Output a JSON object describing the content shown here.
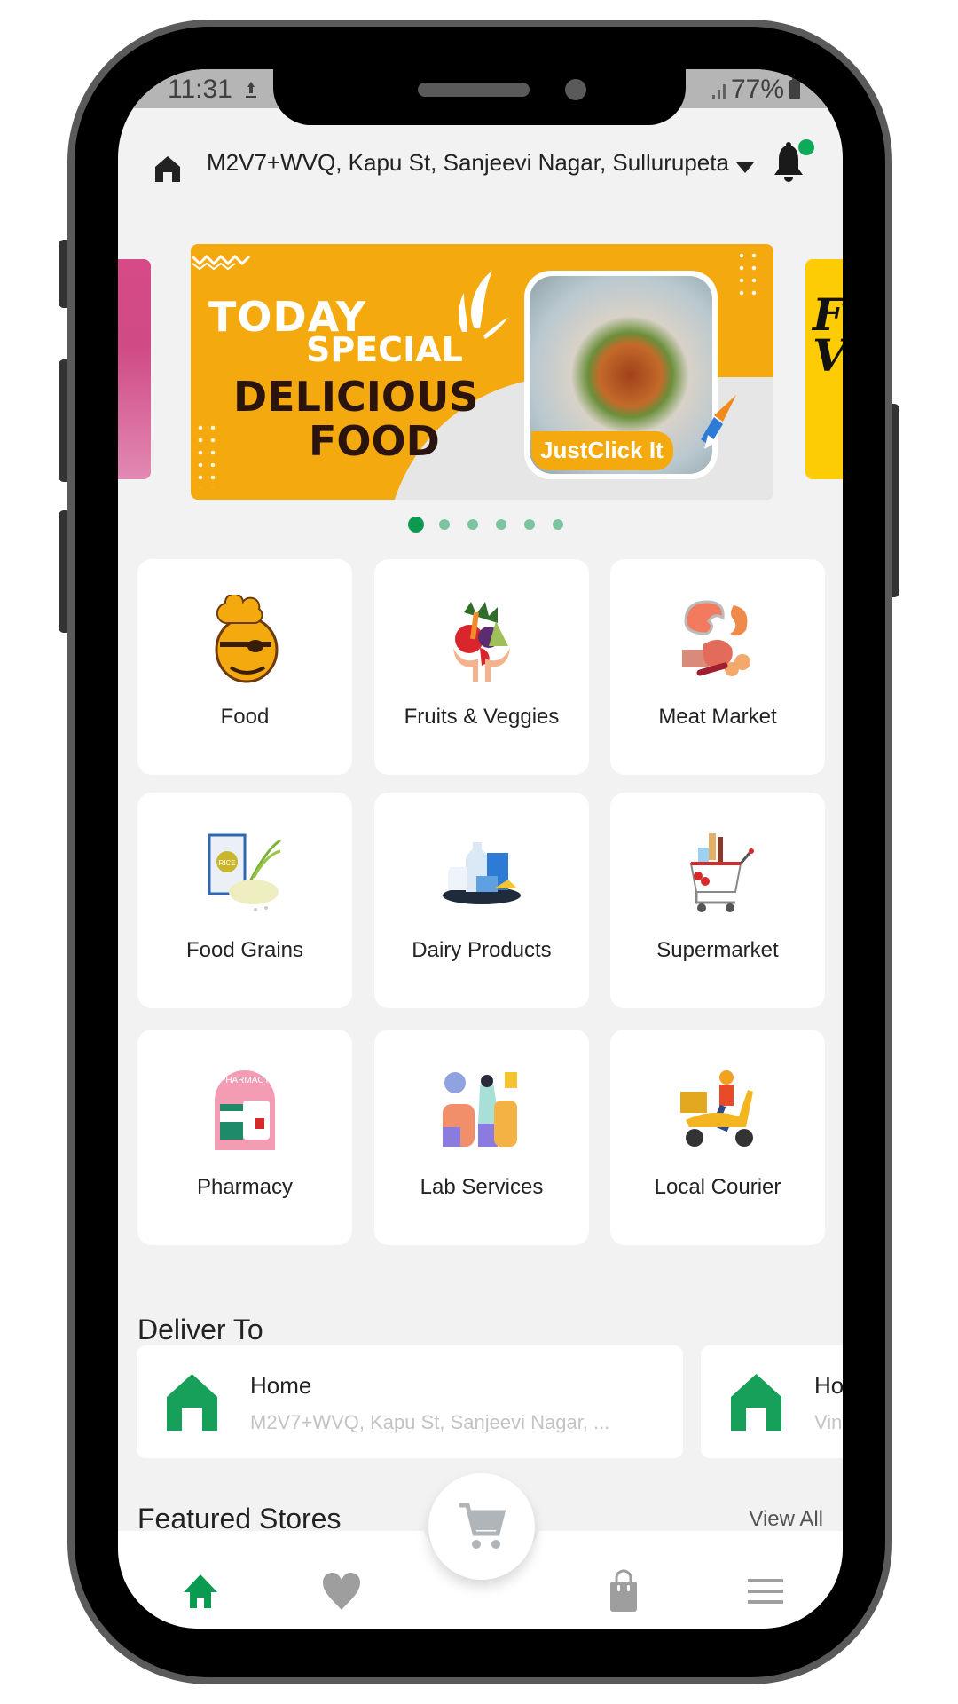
{
  "status_bar": {
    "time": "11:31",
    "battery": "77%",
    "icons": [
      "upload-icon",
      "signal-icon",
      "battery-icon"
    ]
  },
  "header": {
    "location_icon": "home-icon",
    "address": "M2V7+WVQ, Kapu St, Sanjeevi Nagar, Sullurupeta,...",
    "dropdown_icon": "caret-down-icon",
    "notification_icon": "bell-icon",
    "notification_badge_color": "#0fa95a"
  },
  "carousel": {
    "active_banner": {
      "line1": "TODAY",
      "line2": "SPECIAL",
      "line3": "DELICIOUS",
      "line4": "FOOD",
      "badge": "JustClick It"
    },
    "next_banner_text": "Fi\nV",
    "dots_count": 6,
    "active_index": 0,
    "active_color": "#0a9a50",
    "inactive_color": "#7cc4a0"
  },
  "categories": [
    {
      "label": "Food",
      "icon": "chef-food-icon"
    },
    {
      "label": "Fruits & Veggies",
      "icon": "fruits-veggies-icon"
    },
    {
      "label": "Meat Market",
      "icon": "meat-icon"
    },
    {
      "label": "Food Grains",
      "icon": "rice-bag-icon"
    },
    {
      "label": "Dairy Products",
      "icon": "dairy-icon"
    },
    {
      "label": "Supermarket",
      "icon": "shopping-cart-groceries-icon"
    },
    {
      "label": "Pharmacy",
      "icon": "pharmacy-icon"
    },
    {
      "label": "Lab Services",
      "icon": "lab-microscope-icon"
    },
    {
      "label": "Local Courier",
      "icon": "delivery-scooter-icon"
    }
  ],
  "deliver_to": {
    "title": "Deliver To",
    "addresses": [
      {
        "name": "Home",
        "address": "M2V7+WVQ, Kapu St, Sanjeevi Nagar, ..."
      },
      {
        "name": "Ho",
        "address": "Vin"
      }
    ],
    "accent_color": "#16a05a"
  },
  "featured": {
    "title": "Featured Stores",
    "link": "View All"
  },
  "bottom_nav": {
    "items": [
      {
        "name": "home",
        "icon": "home-icon",
        "active": true
      },
      {
        "name": "favorites",
        "icon": "heart-icon",
        "active": false
      },
      {
        "name": "cart",
        "icon": "cart-icon",
        "active": false
      },
      {
        "name": "orders",
        "icon": "shopping-bag-icon",
        "active": false
      },
      {
        "name": "menu",
        "icon": "hamburger-menu-icon",
        "active": false
      }
    ],
    "active_color": "#0a9a50",
    "inactive_color": "#9e9e9e"
  }
}
